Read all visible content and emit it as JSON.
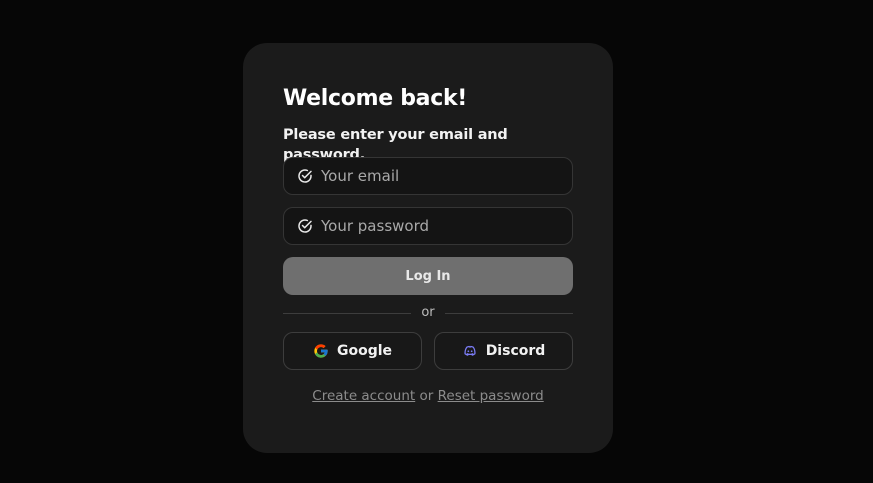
{
  "card": {
    "title": "Welcome back!",
    "subtitle": "Please enter your email and password."
  },
  "form": {
    "email_placeholder": "Your email",
    "password_placeholder": "Your password",
    "field_icon": "check-circle-icon",
    "login_label": "Log In"
  },
  "divider": {
    "label": "or"
  },
  "oauth": {
    "google_label": "Google",
    "google_icon": "google-logo-icon",
    "discord_label": "Discord",
    "discord_icon": "discord-logo-icon",
    "discord_color": "#7b7cf6"
  },
  "footer": {
    "create_account": "Create account",
    "joiner": "or",
    "reset_password": "Reset password"
  },
  "colors": {
    "background": "#060606",
    "card": "#1b1b1b",
    "login_button": "#6f6f6f"
  }
}
